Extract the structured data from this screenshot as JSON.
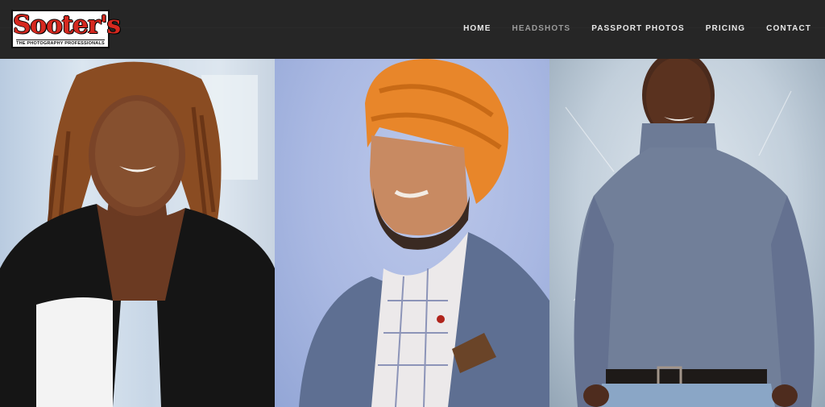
{
  "brand": {
    "name": "Sooter's",
    "tagline": "THE PHOTOGRAPHY PROFESSIONALS"
  },
  "nav": {
    "items": [
      {
        "label": "HOME",
        "active": false
      },
      {
        "label": "HEADSHOTS",
        "active": true
      },
      {
        "label": "PASSPORT PHOTOS",
        "active": false
      },
      {
        "label": "PRICING",
        "active": false
      },
      {
        "label": "CONTACT",
        "active": false
      }
    ]
  },
  "colors": {
    "header_bg": "#262626",
    "logo_red": "#d6281f",
    "nav_text": "#e8e8e8",
    "nav_active": "#9a9a9a"
  },
  "gallery": {
    "photos": [
      {
        "subject": "woman with braided hair in black cardigan"
      },
      {
        "subject": "man in orange turban and gray blazer"
      },
      {
        "subject": "man in blue-gray turtleneck"
      }
    ]
  }
}
